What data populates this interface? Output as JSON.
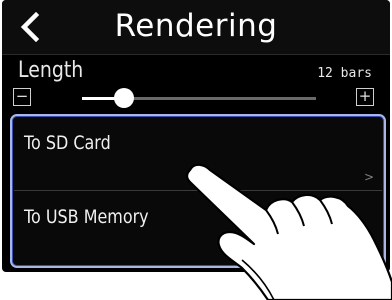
{
  "header": {
    "title": "Rendering",
    "back_icon": "chevron-left-icon"
  },
  "parameter": {
    "label": "Length",
    "value_text": "12 bars",
    "minus_symbol": "−",
    "plus_symbol": "+",
    "slider_fraction": 0.17
  },
  "menu": {
    "items": [
      {
        "label": "To SD Card",
        "chevron": ">"
      },
      {
        "label": "To USB Memory",
        "chevron": ">"
      }
    ]
  },
  "overlay": {
    "icon": "hand-tap-icon"
  },
  "colors": {
    "background": "#000000",
    "highlight_border": "#a9b7e6",
    "text": "#ffffff"
  }
}
